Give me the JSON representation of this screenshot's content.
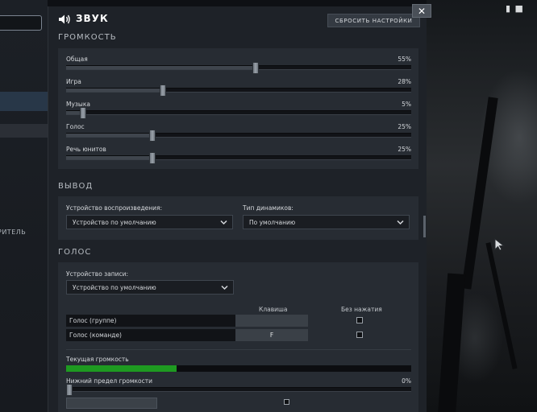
{
  "left": {
    "label": "РИТЕЛЬ"
  },
  "background": {
    "glyph": "▮ ■"
  },
  "dialog": {
    "title": "ЗВУК",
    "reset_label": "СБРОСИТЬ НАСТРОЙКИ",
    "close_label": "✕"
  },
  "volume": {
    "title": "ГРОМКОСТЬ",
    "sliders": [
      {
        "label": "Общая",
        "value": 55,
        "display": "55%"
      },
      {
        "label": "Игра",
        "value": 28,
        "display": "28%"
      },
      {
        "label": "Музыка",
        "value": 5,
        "display": "5%"
      },
      {
        "label": "Голос",
        "value": 25,
        "display": "25%"
      },
      {
        "label": "Речь юнитов",
        "value": 25,
        "display": "25%"
      }
    ]
  },
  "output": {
    "title": "ВЫВОД",
    "device_label": "Устройство воспроизведения:",
    "device_value": "Устройство по умолчанию",
    "speaker_label": "Тип динамиков:",
    "speaker_value": "По умолчанию"
  },
  "voice": {
    "title": "ГОЛОС",
    "record_label": "Устройство записи:",
    "record_value": "Устройство по умолчанию",
    "col_key": "Клавиша",
    "col_no_press": "Без нажатия",
    "rows": [
      {
        "label": "Голос (группе)",
        "key": ""
      },
      {
        "label": "Голос (команде)",
        "key": "F"
      }
    ],
    "current_volume_label": "Текущая громкость",
    "current_volume_level": 0.32,
    "lower_limit_label": "Нижний предел громкости",
    "lower_limit_value": 0,
    "lower_limit_display": "0%"
  },
  "colors": {
    "accent": "#1e9a21",
    "title_icon": "#ffffff"
  }
}
